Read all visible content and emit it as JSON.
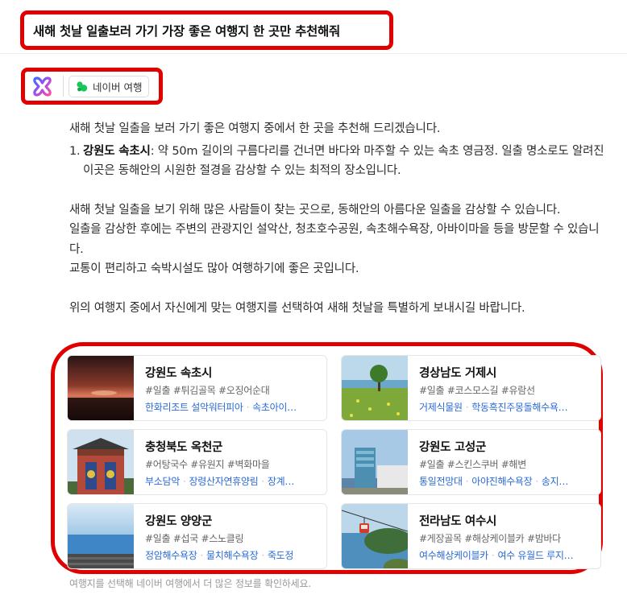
{
  "question": "새해 첫날 일출보러 가기 가장 좋은 여행지 한 곳만 추천해줘",
  "source": {
    "chip_label": "네이버 여행",
    "chip_icon": "naver-travel-icon",
    "logo": "ai-assistant-logo"
  },
  "answer": {
    "intro": "새해 첫날 일출을 보러 가기 좋은 여행지 중에서 한 곳을 추천해 드리겠습니다.",
    "list": [
      {
        "num": "1.",
        "title": "강원도 속초시",
        "desc": ": 약 50m 길이의 구름다리를 건너면 바다와 마주할 수 있는 속초 영금정. 일출 명소로도 알려진 이곳은 동해안의 시원한 절경을 감상할 수 있는 최적의 장소입니다."
      }
    ],
    "para1": "새해 첫날 일출을 보기 위해 많은 사람들이 찾는 곳으로, 동해안의 아름다운 일출을 감상할 수 있습니다.",
    "para2": "일출을 감상한 후에는 주변의 관광지인 설악산, 청초호수공원, 속초해수욕장, 아바이마을 등을 방문할 수 있습니다.",
    "para3": "교통이 편리하고 숙박시설도 많아 여행하기에 좋은 곳입니다.",
    "closing": "위의 여행지 중에서 자신에게 맞는 여행지를 선택하여 새해 첫날을 특별하게 보내시길 바랍니다."
  },
  "cards": [
    {
      "name": "강원도 속초시",
      "tags": "#일출 #튀김골목 #오징어순대",
      "links": [
        "한화리조트 설악워터피아",
        "속초아이…"
      ]
    },
    {
      "name": "경상남도 거제시",
      "tags": "#일출 #코스모스길 #유람선",
      "links": [
        "거제식물원",
        "학동흑진주몽돌해수욕…"
      ]
    },
    {
      "name": "충청북도 옥천군",
      "tags": "#어탕국수 #유원지 #벽화마을",
      "links": [
        "부소담악",
        "장령산자연휴양림",
        "장계…"
      ]
    },
    {
      "name": "강원도 고성군",
      "tags": "#일출 #스킨스쿠버 #해변",
      "links": [
        "통일전망대",
        "아야진해수욕장",
        "송지…"
      ]
    },
    {
      "name": "강원도 양양군",
      "tags": "#일출 #섭국 #스노클링",
      "links": [
        "정암해수욕장",
        "물치해수욕장",
        "죽도정"
      ]
    },
    {
      "name": "전라남도 여수시",
      "tags": "#게장골목 #해상케이블카 #밤바다",
      "links": [
        "여수해상케이블카",
        "여수 유월드 루지…"
      ]
    }
  ],
  "footer_note": "여행지를 선택해 네이버 여행에서 더 많은 정보를 확인하세요."
}
